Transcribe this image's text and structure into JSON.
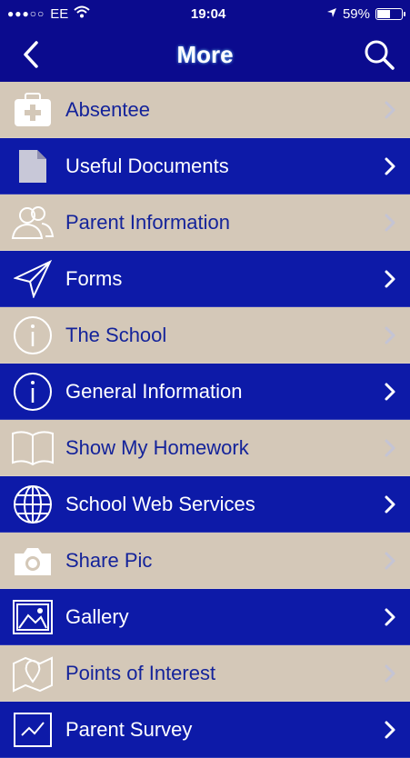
{
  "status_bar": {
    "signal": "●●●○○",
    "carrier": "EE",
    "time": "19:04",
    "battery": "59%",
    "battery_level": 0.59
  },
  "nav": {
    "title": "More",
    "back_icon": "chevron-left-icon",
    "search_icon": "search-icon"
  },
  "colors": {
    "nav_bg": "#0b0b8e",
    "row_beige": "#d4c8b8",
    "row_blue": "#0d1aa8",
    "text_dark": "#14239a"
  },
  "menu": [
    {
      "label": "Absentee",
      "icon": "medical-kit-icon"
    },
    {
      "label": "Useful Documents",
      "icon": "document-icon"
    },
    {
      "label": "Parent Information",
      "icon": "people-icon"
    },
    {
      "label": "Forms",
      "icon": "paper-plane-icon"
    },
    {
      "label": "The School",
      "icon": "info-icon"
    },
    {
      "label": "General Information",
      "icon": "info-icon"
    },
    {
      "label": "Show My Homework",
      "icon": "book-icon"
    },
    {
      "label": "School Web Services",
      "icon": "globe-icon"
    },
    {
      "label": "Share Pic",
      "icon": "camera-icon"
    },
    {
      "label": "Gallery",
      "icon": "image-icon"
    },
    {
      "label": "Points of Interest",
      "icon": "map-pin-icon"
    },
    {
      "label": "Parent Survey",
      "icon": "survey-icon"
    }
  ]
}
